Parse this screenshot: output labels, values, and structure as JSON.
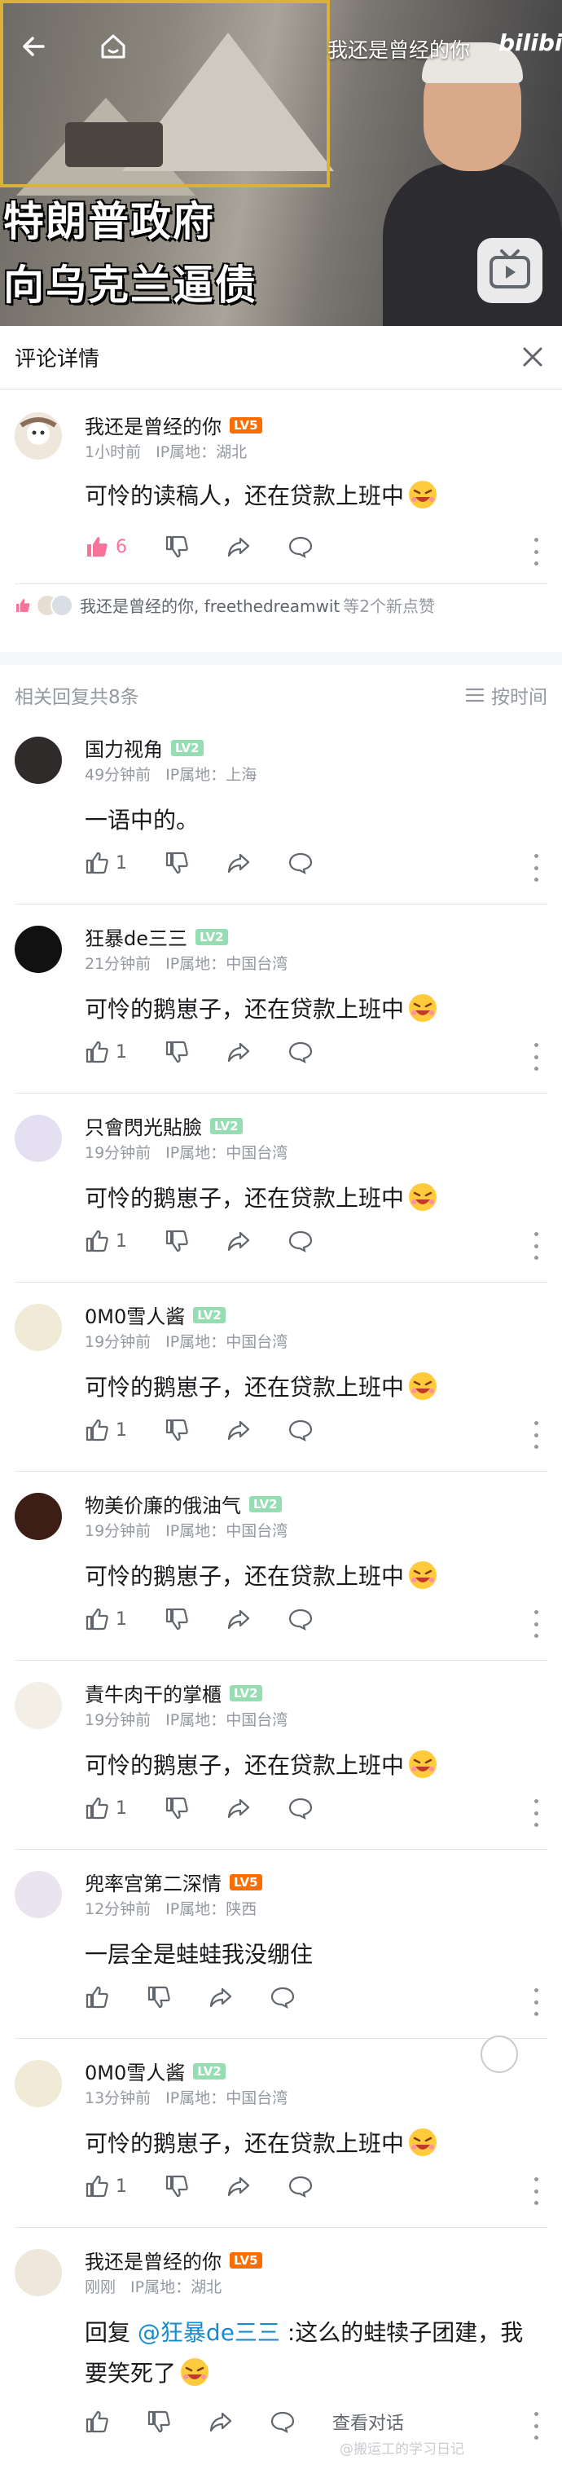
{
  "video": {
    "channel_name": "我还是曾经的你",
    "logo": "bilibili",
    "title_line1": "特朗普政府",
    "title_line2": "向乌克兰逼债",
    "back_icon": "arrow-left-icon",
    "home_icon": "home-icon",
    "tv_icon": "tv-play-icon"
  },
  "detail_header": {
    "title": "评论详情",
    "close_icon": "close-icon"
  },
  "main_comment": {
    "username": "我还是曾经的你",
    "level": "LV5",
    "time": "1小时前",
    "ip": "IP属地：湖北",
    "text": "可怜的读稿人，还在贷款上班中",
    "likes": "6",
    "likers": "我还是曾经的你, freethedreamwit",
    "likers_suffix": "等2个新点赞"
  },
  "replies_header": {
    "label": "相关回复共8条",
    "sort_label": "按时间"
  },
  "replies": [
    {
      "username": "国力视角",
      "level": "LV2",
      "time": "49分钟前",
      "ip": "IP属地：上海",
      "text": "一语中的。",
      "likes": "1",
      "emoji": false
    },
    {
      "username": "狂暴de三三",
      "level": "LV2",
      "time": "21分钟前",
      "ip": "IP属地：中国台湾",
      "text": "可怜的鹅崽子，还在贷款上班中",
      "likes": "1",
      "emoji": true
    },
    {
      "username": "只會閃光貼臉",
      "level": "LV2",
      "time": "19分钟前",
      "ip": "IP属地：中国台湾",
      "text": "可怜的鹅崽子，还在贷款上班中",
      "likes": "1",
      "emoji": true
    },
    {
      "username": "0M0雪人酱",
      "level": "LV2",
      "time": "19分钟前",
      "ip": "IP属地：中国台湾",
      "text": "可怜的鹅崽子，还在贷款上班中",
      "likes": "1",
      "emoji": true
    },
    {
      "username": "物美价廉的俄油气",
      "level": "LV2",
      "time": "19分钟前",
      "ip": "IP属地：中国台湾",
      "text": "可怜的鹅崽子，还在贷款上班中",
      "likes": "1",
      "emoji": true
    },
    {
      "username": "責牛肉干的掌櫃",
      "level": "LV2",
      "time": "19分钟前",
      "ip": "IP属地：中国台湾",
      "text": "可怜的鹅崽子，还在贷款上班中",
      "likes": "1",
      "emoji": true
    },
    {
      "username": "兜率宫第二深情",
      "level": "LV5",
      "time": "12分钟前",
      "ip": "IP属地：陕西",
      "text": "一层全是蛙蛙我没绷住",
      "likes": "",
      "emoji": false
    },
    {
      "username": "0M0雪人酱",
      "level": "LV2",
      "time": "13分钟前",
      "ip": "IP属地：中国台湾",
      "text": "可怜的鹅崽子，还在贷款上班中",
      "likes": "1",
      "emoji": true
    },
    {
      "username": "我还是曾经的你",
      "level": "LV5",
      "time": "刚刚",
      "ip": "IP属地：湖北",
      "reply_prefix": "回复",
      "reply_target": "@狂暴de三三",
      "text": ":这么的蛙犊子团建，我要笑死了",
      "likes": "",
      "emoji": true,
      "view_conversation": "查看对话"
    }
  ],
  "watermark": "@搬运工的学习日记",
  "colors": {
    "accent_pink": "#fb7299",
    "link_blue": "#178bcf",
    "lv5_orange": "#ff6c00",
    "lv2_green": "#95ddb2"
  }
}
